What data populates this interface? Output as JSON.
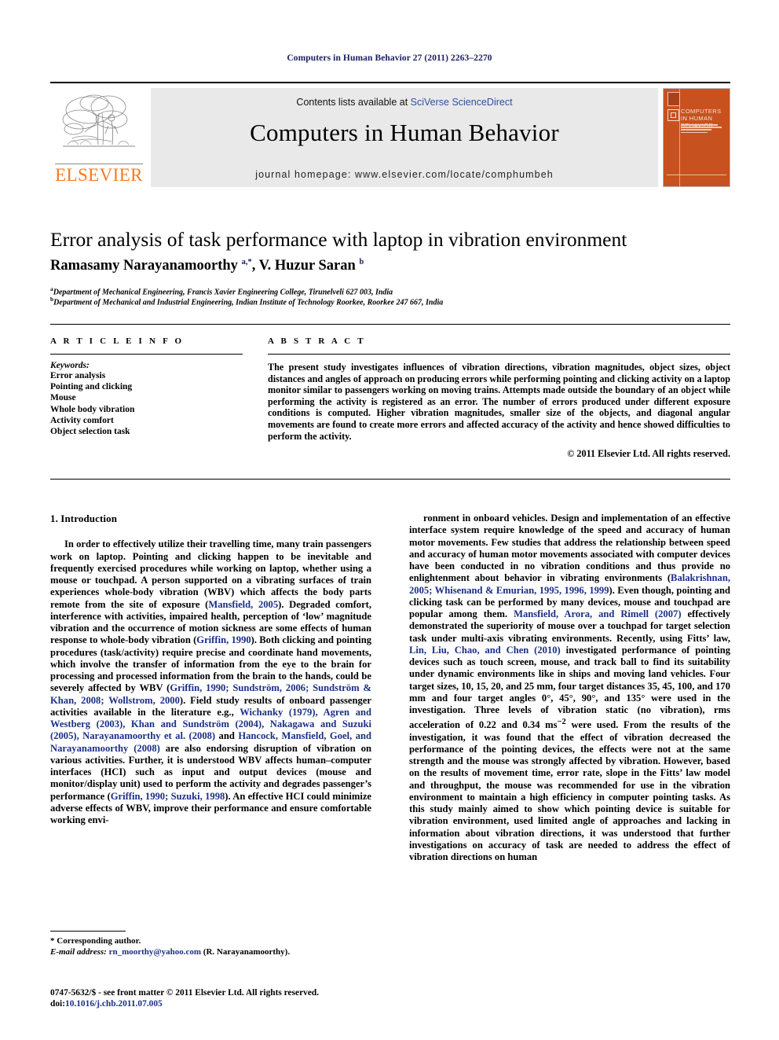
{
  "running_head": "Computers in Human Behavior 27 (2011) 2263–2270",
  "masthead": {
    "contents_prefix": "Contents lists available at ",
    "sciencedirect": "SciVerse ScienceDirect",
    "journal_title": "Computers in Human Behavior",
    "homepage": "journal homepage: www.elsevier.com/locate/comphumbeh",
    "publisher_wordmark": "ELSEVIER",
    "cover_title": "COMPUTERS IN HUMAN BEHAVIOR",
    "accent_color": "#c8521f",
    "link_color": "#2f4ea1"
  },
  "article": {
    "title": "Error analysis of task performance with laptop in vibration environment",
    "authors_html": "Ramasamy Narayanamoorthy <sup>a,</sup><sup>*</sup>, V. Huzur Saran <sup>b</sup>",
    "affiliation_a": "Department of Mechanical Engineering, Francis Xavier Engineering College, Tirunelveli 627 003, India",
    "affiliation_b": "Department of Mechanical and Industrial Engineering, Indian Institute of Technology Roorkee, Roorkee 247 667, India"
  },
  "info": {
    "heading": "A R T I C L E   I N F O",
    "keywords_label": "Keywords:",
    "keywords": [
      "Error analysis",
      "Pointing and clicking",
      "Mouse",
      "Whole body vibration",
      "Activity comfort",
      "Object selection task"
    ]
  },
  "abstract": {
    "heading": "A B S T R A C T",
    "text": "The present study investigates influences of vibration directions, vibration magnitudes, object sizes, object distances and angles of approach on producing errors while performing pointing and clicking activity on a laptop monitor similar to passengers working on moving trains. Attempts made outside the boundary of an object while performing the activity is registered as an error. The number of errors produced under different exposure conditions is computed. Higher vibration magnitudes, smaller size of the objects, and diagonal angular movements are found to create more errors and affected accuracy of the activity and hence showed difficulties to perform the activity.",
    "copyright": "© 2011 Elsevier Ltd. All rights reserved."
  },
  "body": {
    "section_heading": "1. Introduction",
    "left_paragraph_parts": [
      {
        "t": "In order to effectively utilize their travelling time, many train passengers work on laptop. Pointing and clicking happen to be inevitable and frequently exercised procedures while working on laptop, whether using a mouse or touchpad. A person supported on a vibrating surfaces of train experiences whole-body vibration (WBV) which affects the body parts remote from the site of exposure (",
        "r": false
      },
      {
        "t": "Mansfield, 2005",
        "r": true
      },
      {
        "t": "). Degraded comfort, interference with activities, impaired health, perception of ‘low’ magnitude vibration and the occurrence of motion sickness are some effects of human response to whole-body vibration (",
        "r": false
      },
      {
        "t": "Griffin, 1990",
        "r": true
      },
      {
        "t": "). Both clicking and pointing procedures (task/activity) require precise and coordinate hand movements, which involve the transfer of information from the eye to the brain for processing and processed information from the brain to the hands, could be severely affected by WBV (",
        "r": false
      },
      {
        "t": "Griffin, 1990; Sundström, 2006; Sundström & Khan, 2008; Wollstrom, 2000",
        "r": true
      },
      {
        "t": "). Field study results of onboard passenger activities available in the literature e.g., ",
        "r": false
      },
      {
        "t": "Wichanky (1979), Agren and Westberg (2003), Khan and Sundström (2004), Nakagawa and Suzuki (2005), Narayanamoorthy et al. (2008)",
        "r": true
      },
      {
        "t": " and ",
        "r": false
      },
      {
        "t": "Hancock, Mansfield, Goel, and Narayanamoorthy (2008)",
        "r": true
      },
      {
        "t": " are also endorsing disruption of vibration on various activities. Further, it is understood WBV affects human–computer interfaces (HCI) such as input and output devices (mouse and monitor/display unit) used to perform the activity and degrades passenger’s performance (",
        "r": false
      },
      {
        "t": "Griffin, 1990; Suzuki, 1998",
        "r": true
      },
      {
        "t": "). An effective HCI could minimize adverse effects of WBV, improve their performance and ensure comfortable working envi-",
        "r": false
      }
    ],
    "right_paragraph_parts": [
      {
        "t": "ronment in onboard vehicles. Design and implementation of an effective interface system require knowledge of the speed and accuracy of human motor movements. Few studies that address the relationship between speed and accuracy of human motor movements associated with computer devices have been conducted in no vibration conditions and thus provide no enlightenment about behavior in vibrating environments (",
        "r": false
      },
      {
        "t": "Balakrishnan, 2005; Whisenand & Emurian, 1995, 1996, 1999",
        "r": true
      },
      {
        "t": "). Even though, pointing and clicking task can be performed by many devices, mouse and touchpad are popular among them. ",
        "r": false
      },
      {
        "t": "Mansfield, Arora, and Rimell (2007)",
        "r": true
      },
      {
        "t": " effectively demonstrated the superiority of mouse over a touchpad for target selection task under multi-axis vibrating environments. Recently, using Fitts’ law, ",
        "r": false
      },
      {
        "t": "Lin, Liu, Chao, and Chen (2010)",
        "r": true
      },
      {
        "t": " investigated performance of pointing devices such as touch screen, mouse, and track ball to find its suitability under dynamic environments like in ships and moving land vehicles. Four target sizes, 10, 15, 20, and 25 mm, four target distances 35, 45, 100, and 170 mm and four target angles 0°, 45°, 90°, and 135° were used in the investigation. Three levels of vibration static (no vibration), rms acceleration of 0.22 and 0.34 ms",
        "r": false
      },
      {
        "t": "SUP:−2",
        "r": false
      },
      {
        "t": " were used. From the results of the investigation, it was found that the effect of vibration decreased the performance of the pointing devices, the effects were not at the same strength and the mouse was strongly affected by vibration. However, based on the results of movement time, error rate, slope in the Fitts’ law model and throughput, the mouse was recommended for use in the vibration environment to maintain a high efficiency in computer pointing tasks. As this study mainly aimed to show which pointing device is suitable for vibration environment, used limited angle of approaches and lacking in information about vibration directions, it was understood that further investigations on accuracy of task are needed to address the effect of vibration directions on human",
        "r": false
      }
    ]
  },
  "footnote": {
    "corresponding": "* Corresponding author.",
    "email_label": "E-mail address:",
    "email": "rn_moorthy@yahoo.com",
    "email_owner": "(R. Narayanamoorthy)."
  },
  "imprint": {
    "line1": "0747-5632/$ - see front matter © 2011 Elsevier Ltd. All rights reserved.",
    "doi_label": "doi:",
    "doi": "10.1016/j.chb.2011.07.005"
  }
}
